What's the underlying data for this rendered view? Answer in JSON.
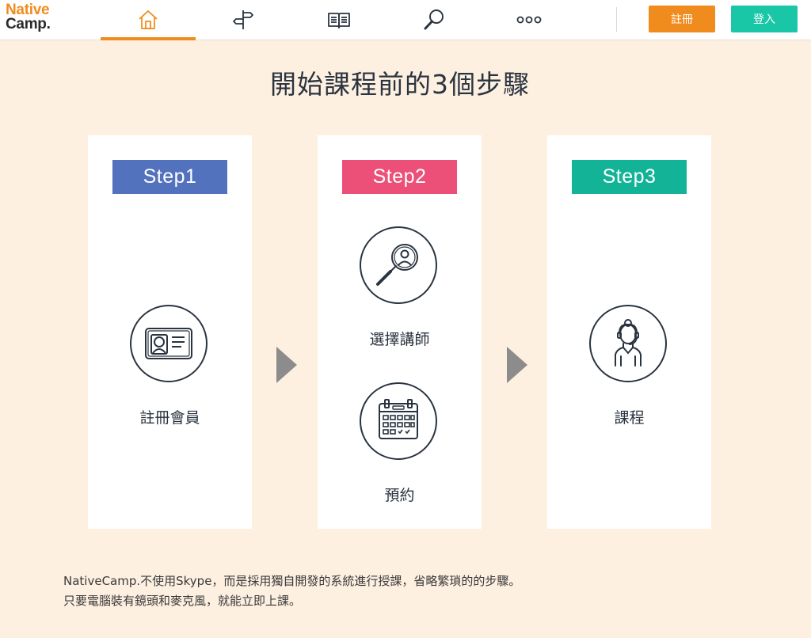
{
  "header": {
    "logo_line1": "Native",
    "logo_line2": "Camp.",
    "nav": [
      {
        "icon": "home-icon",
        "active": true
      },
      {
        "icon": "signpost-icon",
        "active": false
      },
      {
        "icon": "book-icon",
        "active": false
      },
      {
        "icon": "search-icon",
        "active": false
      },
      {
        "icon": "more-icon",
        "active": false
      }
    ],
    "register_label": "註冊",
    "login_label": "登入"
  },
  "main": {
    "title": "開始課程前的3個步驟",
    "steps": [
      {
        "badge": "Step1",
        "badge_color": "#5272bd",
        "items": [
          {
            "icon": "id-card-icon",
            "label": "註冊會員"
          }
        ]
      },
      {
        "badge": "Step2",
        "badge_color": "#ec4f78",
        "items": [
          {
            "icon": "search-teacher-icon",
            "label": "選擇講師"
          },
          {
            "icon": "calendar-icon",
            "label": "預約"
          }
        ]
      },
      {
        "badge": "Step3",
        "badge_color": "#13b397",
        "items": [
          {
            "icon": "teacher-headset-icon",
            "label": "課程"
          }
        ]
      }
    ],
    "arrow_color": "#8c8c8c"
  },
  "footer": {
    "line1": "NativeCamp.不使用Skype，而是採用獨自開發的系統進行授課，省略繁瑣的的步驟。",
    "line2": "只要電腦裝有鏡頭和麥克風，就能立即上課。"
  },
  "colors": {
    "accent": "#f08c1e",
    "login": "#19c7a6",
    "background": "#fdf0e1",
    "icon_stroke": "#2a3440"
  }
}
